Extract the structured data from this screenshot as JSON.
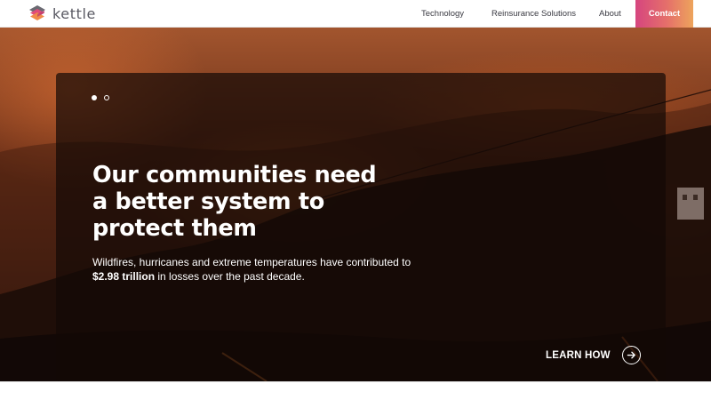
{
  "brand": {
    "name": "kettle",
    "logo_icon": "kettle-layered-cube-logo",
    "logo_colors": [
      "#e04a7a",
      "#f08a4a",
      "#6a6a72"
    ]
  },
  "nav": {
    "items": [
      {
        "label": "Technology"
      },
      {
        "label": "Reinsurance Solutions"
      },
      {
        "label": "About"
      }
    ],
    "contact_label": "Contact",
    "contact_gradient": [
      "#d6457f",
      "#eda45c"
    ]
  },
  "hero": {
    "slides": {
      "count": 2,
      "active_index": 0
    },
    "headline": "Our communities need a better system to protect them",
    "subtext_prefix": "Wildfires, hurricanes and extreme temperatures have contributed to",
    "subtext_highlight": "$2.98 trillion",
    "subtext_suffix": "in losses over the past decade.",
    "cta_label": "LEARN HOW",
    "cta_icon": "arrow-right-circle-icon"
  }
}
